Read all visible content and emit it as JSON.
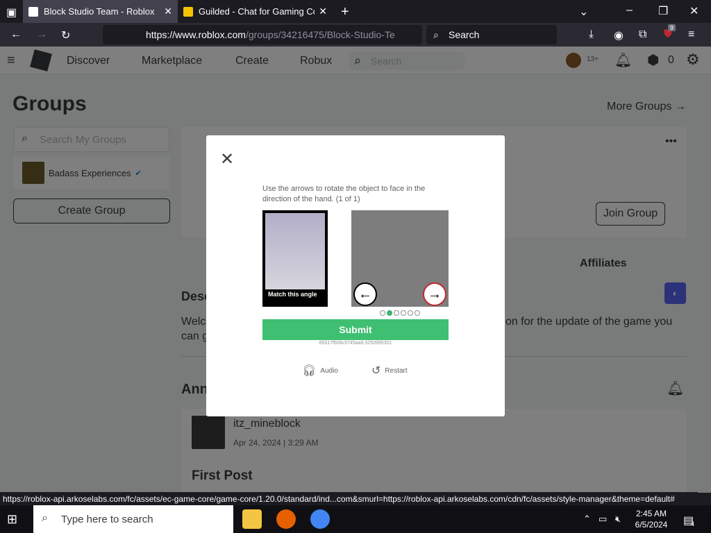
{
  "browser": {
    "tabs": [
      {
        "title": "Block Studio Team - Roblox"
      },
      {
        "title": "Guilded - Chat for Gaming Com"
      }
    ],
    "url_host": "https://www.roblox.com",
    "url_path": "/groups/34216475/Block-Studio-Te",
    "search_placeholder": "Search",
    "notifications_badge": "9",
    "status_url": "https://roblox-api.arkoselabs.com/fc/assets/ec-game-core/game-core/1.20.0/standard/ind...com&smurl=https://roblox-api.arkoselabs.com/cdn/fc/assets/style-manager&theme=default#"
  },
  "roblox_header": {
    "nav": [
      "Discover",
      "Marketplace",
      "Create",
      "Robux"
    ],
    "search_placeholder": "Search",
    "age_label": "13+",
    "robux_count": "0"
  },
  "groups_page": {
    "title": "Groups",
    "more_groups": "More Groups →",
    "search_placeholder": "Search My Groups",
    "group_item": "Badass Experiences",
    "create_group": "Create Group",
    "join_group": "Join Group",
    "affiliates_tab": "Affiliates",
    "description_heading": "Desc",
    "description_line1": "Welc",
    "description_line1_right": "tion for the update of the game you",
    "description_line2": "can g",
    "announcements_heading": "Ann",
    "post_user": "itz_mineblock",
    "post_date": "Apr 24, 2024 | 3:29 AM",
    "post_title": "First Post"
  },
  "captcha": {
    "instruction": "Use the arrows to rotate the object to face in the direction of the hand. (1 of 1)",
    "hand_label": "Match this angle",
    "submit_label": "Submit",
    "session_id": "69317f606c5745aa9.3250995301",
    "audio_label": "Audio",
    "restart_label": "Restart",
    "pagination_total": 6,
    "pagination_active": 2
  },
  "taskbar": {
    "search_placeholder": "Type here to search",
    "time": "2:45 AM",
    "date": "6/5/2024",
    "notification_count": "4"
  }
}
